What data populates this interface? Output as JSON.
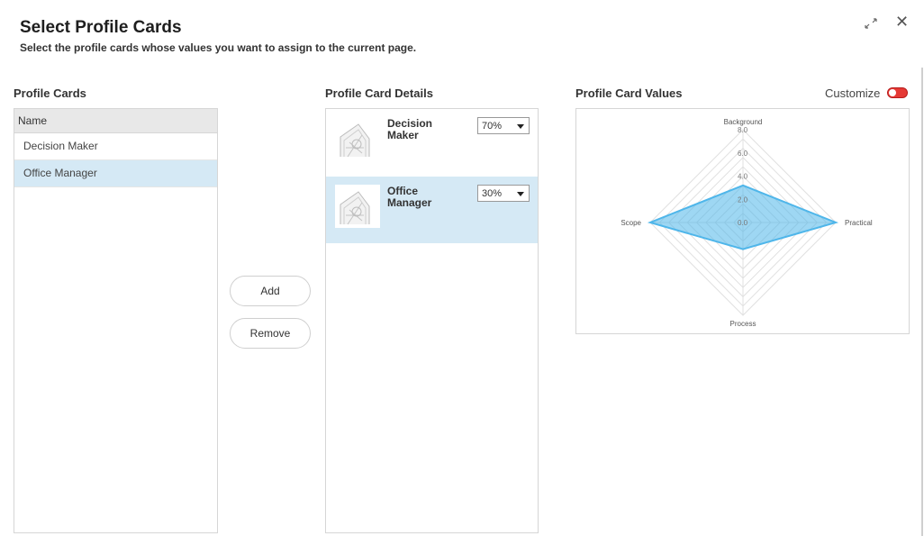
{
  "dialog": {
    "title": "Select Profile Cards",
    "subtitle": "Select the profile cards whose values you want to assign to the current page."
  },
  "profile_cards": {
    "title": "Profile Cards",
    "column_header": "Name",
    "items": [
      {
        "label": "Decision Maker",
        "selected": false
      },
      {
        "label": "Office Manager",
        "selected": true
      }
    ]
  },
  "actions": {
    "add_label": "Add",
    "remove_label": "Remove"
  },
  "details": {
    "title": "Profile Card Details",
    "items": [
      {
        "name": "Decision Maker",
        "weight": "70%",
        "selected": false
      },
      {
        "name": "Office Manager",
        "weight": "30%",
        "selected": true
      }
    ]
  },
  "values": {
    "title": "Profile Card Values",
    "customize_label": "Customize",
    "customize_on": true
  },
  "colors": {
    "selection": "#d5e9f5",
    "radar_fill": "#4fb6ea",
    "toggle": "#e53935"
  },
  "chart_data": {
    "type": "radar",
    "axes": [
      "Background",
      "Practical",
      "Process",
      "Scope"
    ],
    "ticks": [
      "0.0",
      "2.0",
      "4.0",
      "6.0",
      "8.0"
    ],
    "range": [
      0,
      8
    ],
    "values": [
      3.2,
      8.0,
      2.3,
      8.0
    ]
  }
}
